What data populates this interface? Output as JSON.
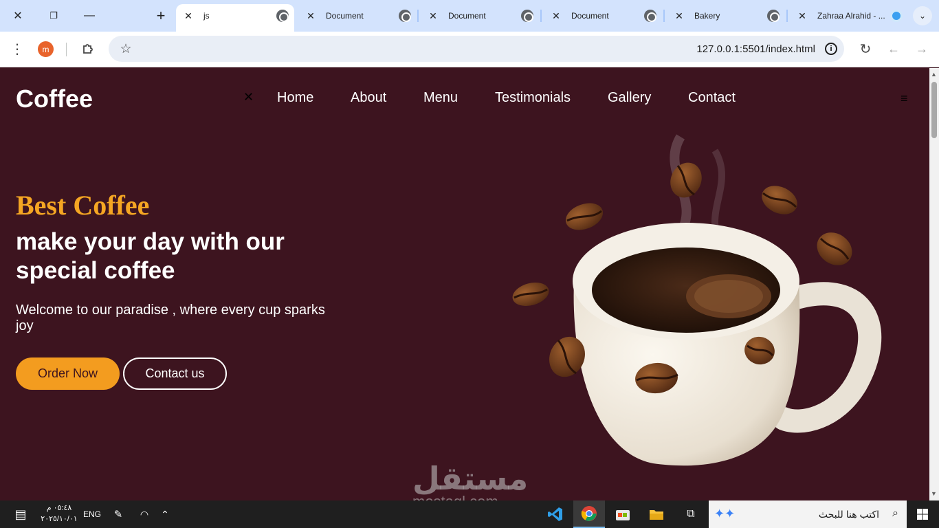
{
  "browser": {
    "tabs": [
      {
        "title": "js",
        "active": true
      },
      {
        "title": "Document"
      },
      {
        "title": "Document"
      },
      {
        "title": "Document"
      },
      {
        "title": "Bakery"
      },
      {
        "title": "Zahraa Alrahid - ..."
      }
    ],
    "url": "127.0.0.1:5501/index.html",
    "profile_initial": "m"
  },
  "site": {
    "logo": "Coffee",
    "nav": [
      "Home",
      "About",
      "Menu",
      "Testimonials",
      "Gallery",
      "Contact"
    ],
    "hero": {
      "eyebrow": "Best Coffee",
      "headline": "make your day with our special coffee",
      "welcome": "Welcome to our paradise , where every cup sparks joy",
      "primary_button": "Order Now",
      "secondary_button": "Contact us"
    },
    "colors": {
      "background": "#3d141f",
      "accent": "#f39c1f"
    }
  },
  "watermark": {
    "arabic": "مستقل",
    "latin": "mostaql.com"
  },
  "taskbar": {
    "time": "٠٥:٤٨ م",
    "date": "٢٠٢٥/١٠/٠١",
    "language": "ENG",
    "search_placeholder": "اكتب هنا للبحث"
  }
}
